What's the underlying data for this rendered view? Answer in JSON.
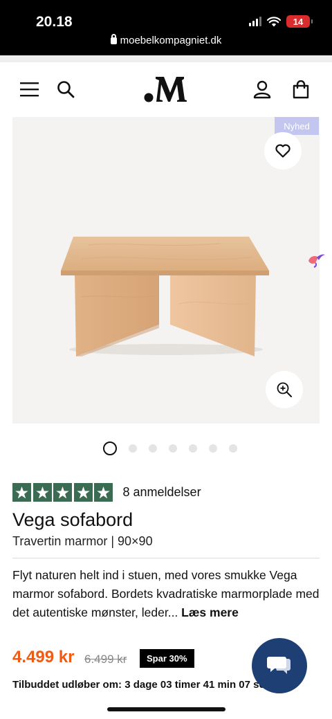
{
  "status": {
    "time": "20.18",
    "battery": "14",
    "url": "moebelkompagniet.dk"
  },
  "header": {
    "icons": [
      "menu-icon",
      "search-icon",
      "brand-logo",
      "account-icon",
      "cart-icon"
    ]
  },
  "product": {
    "badge": "Nyhed",
    "gallery_dots": 7,
    "active_dot": 1,
    "rating_stars": 5,
    "reviews": "8 anmeldelser",
    "title": "Vega sofabord",
    "subtitle": "Travertin marmor | 90×90",
    "description": "Flyt naturen helt ind i stuen, med vores smukke Vega marmor sofabord. Bordets kvadratiske marmorplade med det autentiske mønster, leder...",
    "read_more": "Læs mere",
    "price": "4.499 kr",
    "old_price": "6.499 kr",
    "save": "Spar 30%",
    "countdown": "Tilbuddet udløber om: 3 dage 03 timer 41 min 07 sek"
  },
  "colors": {
    "price": "#f05a12",
    "stars": "#3b6b53",
    "badge": "#c3c7ef",
    "chat": "#1e3f74"
  }
}
